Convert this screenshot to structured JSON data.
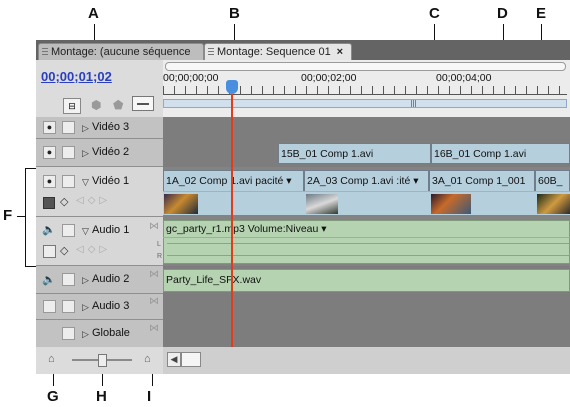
{
  "callouts": {
    "a": "A",
    "b": "B",
    "c": "C",
    "d": "D",
    "e": "E",
    "f": "F",
    "g": "G",
    "h": "H",
    "i": "I"
  },
  "tabs": [
    {
      "label": "Montage: (aucune séquence"
    },
    {
      "label": "Montage: Sequence 01",
      "close": "×"
    }
  ],
  "timecode": "00;00;01;02",
  "ruler": {
    "ticks": [
      "00;00;00;00",
      "00;00;02;00",
      "00;00;04;00"
    ]
  },
  "tracks": {
    "video3": "Vidéo 3",
    "video2": "Vidéo 2",
    "video1": "Vidéo 1",
    "audio1": "Audio 1",
    "audio2": "Audio 2",
    "audio3": "Audio 3",
    "master": "Globale"
  },
  "clips": {
    "v2a": "15B_01 Comp 1.avi",
    "v2b": "16B_01 Comp 1.avi",
    "v1a": "1A_02 Comp 1.avi pacité ▾",
    "v1b": "2A_03 Comp 1.avi :ité ▾",
    "v1c": "3A_01 Comp 1_001",
    "v1d": "60B_",
    "a1": "gc_party_r1.mp3 Volume:Niveau ▾",
    "a2": "Party_Life_SFX.wav"
  },
  "channels": {
    "left": "L",
    "right": "R"
  },
  "colors": {
    "timecode": "#2a3fbf",
    "playhead": "#e23c1a",
    "videoClip": "#b5cfdc",
    "audioClip": "#b5d3b0",
    "cti": "#4a8ee0"
  }
}
